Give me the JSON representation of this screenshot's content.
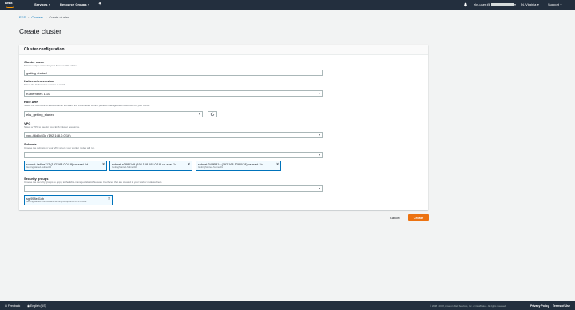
{
  "topnav": {
    "logo_text": "aws",
    "services_label": "Services",
    "resource_groups_label": "Resource Groups",
    "account_label": "eks-user @",
    "region_label": "N. Virginia",
    "support_label": "Support"
  },
  "breadcrumb": {
    "items": [
      "EKS",
      "Clusters",
      "Create cluster"
    ]
  },
  "page_title": "Create cluster",
  "panel": {
    "title": "Cluster configuration",
    "cluster_name": {
      "label": "Cluster name",
      "description": "Enter a unique name for your Amazon EKS cluster.",
      "value": "getting-started"
    },
    "kubernetes_version": {
      "label": "Kubernetes version",
      "description": "Select the Kubernetes version to install.",
      "value": "Kubernetes 1.10"
    },
    "role_arn": {
      "label": "Role ARN",
      "description": "Select the IAM Role to allow Amazon EKS and the Kubernetes control plane to manage AWS resources on your behalf.",
      "value": "eks_getting_started"
    },
    "vpc": {
      "label": "VPC",
      "description": "Select a VPC to use for your EKS Cluster resources.",
      "value": "vpc-46d5c53d (192.168.0.0/16)"
    },
    "subnets": {
      "label": "Subnets",
      "description": "Choose the subnets in your VPC where your worker nodes will run.",
      "value": "",
      "tokens": [
        {
          "main": "subnet-4e6be112 (192.168.0.0/18)   us-east-1d",
          "sub": "GettingStarted-Subnet03"
        },
        {
          "main": "subnet-a38811c9 (192.168.192.0/18)   us-east-1c",
          "sub": "GettingStarted-Subnet02"
        },
        {
          "main": "subnet-348f581a (192.168.128.0/18)   us-east-1b",
          "sub": "GettingStarted-Subnet01"
        }
      ]
    },
    "security_groups": {
      "label": "Security groups",
      "description": "Choose the security groups to apply to the EKS-managed Elastic Network Interfaces that are created in your worker node subnets.",
      "value": "",
      "tokens": [
        {
          "main": "sg-958e81db",
          "sub": "GettingStarted-ControlPlaneSecurityGroup-9FDLU6V1TRRE"
        }
      ]
    }
  },
  "actions": {
    "cancel_label": "Cancel",
    "create_label": "Create"
  },
  "bottombar": {
    "feedback_label": "Feedback",
    "language_label": "English (US)",
    "copyright": "© 2008 - 2018, Amazon Web Services, Inc. or its affiliates. All rights reserved.",
    "privacy_label": "Privacy Policy",
    "terms_label": "Terms of Use"
  },
  "colors": {
    "nav_bg": "#232f3e",
    "accent_orange": "#ec7211",
    "link_blue": "#0073bb",
    "token_bg": "#f1faff"
  }
}
